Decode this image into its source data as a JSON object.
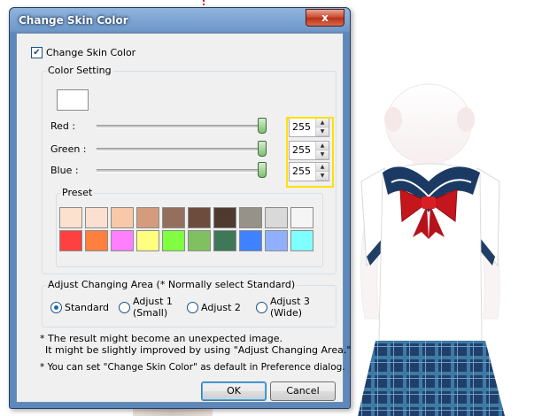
{
  "window": {
    "title": "Change Skin Color",
    "close_glyph": "x"
  },
  "change_skin_color": {
    "label": "Change Skin Color",
    "checked": true,
    "check_glyph": "✔"
  },
  "color_setting": {
    "title": "Color Setting",
    "current_color": "#ffffff",
    "red": {
      "label": "Red :",
      "value": "255",
      "level": 1.0
    },
    "green": {
      "label": "Green :",
      "value": "255",
      "level": 1.0
    },
    "blue": {
      "label": "Blue :",
      "value": "255",
      "level": 1.0
    },
    "spin_up": "▲",
    "spin_down": "▼"
  },
  "preset": {
    "title": "Preset",
    "row1": [
      "#fde1cf",
      "#fbe0d2",
      "#f8c8a8",
      "#d49b7c",
      "#93705e",
      "#6d4c3e",
      "#4f3a30",
      "#969189",
      "#d9d9d9",
      "#f5f5f5"
    ],
    "row2": [
      "#ff4040",
      "#ff7f3f",
      "#ff7fff",
      "#ffff7f",
      "#80ff40",
      "#80c060",
      "#3e7858",
      "#3f82ff",
      "#90b0ff",
      "#80ffff"
    ]
  },
  "adjust_area": {
    "title": "Adjust Changing Area  (* Normally select Standard)",
    "options": [
      {
        "line1": "Standard",
        "line2": "",
        "selected": true
      },
      {
        "line1": "Adjust 1",
        "line2": "(Small)",
        "selected": false
      },
      {
        "line1": "Adjust 2",
        "line2": "",
        "selected": false
      },
      {
        "line1": "Adjust 3",
        "line2": "(Wide)",
        "selected": false
      }
    ]
  },
  "notes": {
    "line1": "* The result might become an unexpected image.",
    "line2": "It might be slightly improved by using \"Adjust Changing Area.\"",
    "line3": "* You can set \"Change Skin Color\" as default in Preference dialog."
  },
  "buttons": {
    "ok": "OK",
    "cancel": "Cancel"
  }
}
